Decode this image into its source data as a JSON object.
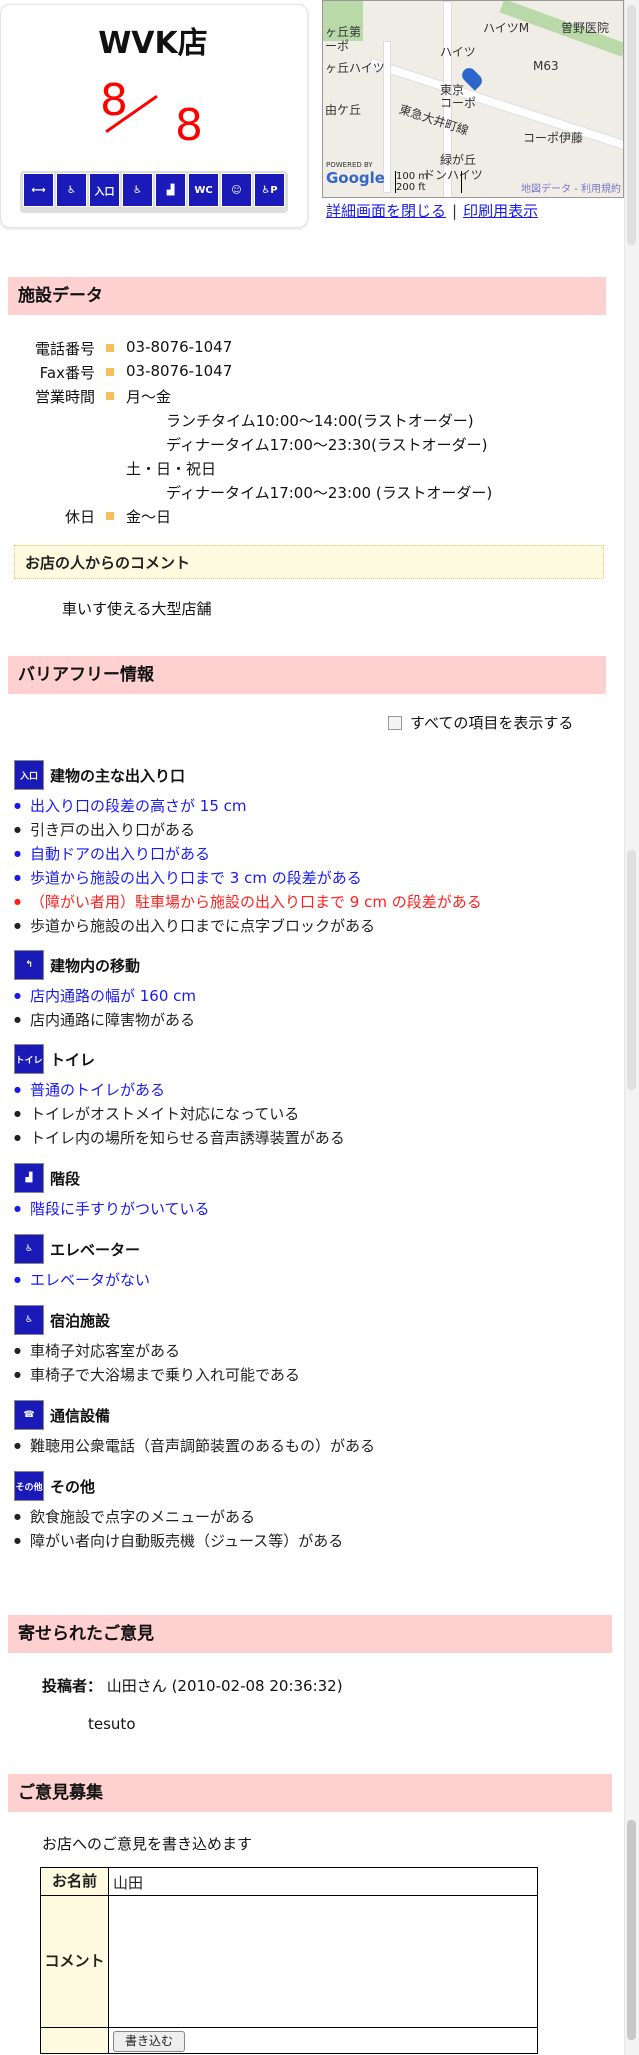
{
  "store": {
    "name": "WVK店",
    "score_num": "8",
    "score_den": "8"
  },
  "icons": [
    "entrance-width-icon",
    "slope-icon",
    "entrance-icon",
    "elevator-icon",
    "stairs-icon",
    "toilet-icon",
    "assist-icon",
    "parking-icon"
  ],
  "map": {
    "labels": [
      "ヶ丘第",
      "ーポ",
      "ヶ丘ハイツ",
      "ハイツ",
      "由ケ丘",
      "東京",
      "コーポ",
      "曽野医院",
      "ハイツM",
      "M63",
      "東急大井町線",
      "コーポ伊藤",
      "緑が丘",
      "ドンハイツ",
      "POWERED BY",
      "Google",
      "100 m",
      "200 ft",
      "地図データ",
      "利用規約"
    ],
    "close_link": "詳細画面を閉じる",
    "print_link": "印刷用表示"
  },
  "facility": {
    "header": "施設データ",
    "phone_label": "電話番号",
    "phone": "03-8076-1047",
    "fax_label": "Fax番号",
    "fax": "03-8076-1047",
    "hours_label": "営業時間",
    "hours": [
      "月〜金",
      "ランチタイム10:00〜14:00(ラストオーダー)",
      "ディナータイム17:00〜23:30(ラストオーダー)",
      "土・日・祝日",
      "ディナータイム17:00〜23:00 (ラストオーダー)"
    ],
    "holiday_label": "休日",
    "holiday": "金〜日",
    "comment_header": "お店の人からのコメント",
    "comment": "車いす使える大型店舗"
  },
  "barrier": {
    "header": "バリアフリー情報",
    "show_all": "すべての項目を表示する",
    "categories": [
      {
        "title": "建物の主な出入り口",
        "icon": "入口",
        "items": [
          {
            "text": "出入り口の段差の高さが 15 cm",
            "color": "blue"
          },
          {
            "text": "引き戸の出入り口がある",
            "color": "black"
          },
          {
            "text": "自動ドアの出入り口がある",
            "color": "blue"
          },
          {
            "text": "歩道から施設の出入り口まで 3 cm の段差がある",
            "color": "blue"
          },
          {
            "text": "（障がい者用）駐車場から施設の出入り口まで 9 cm の段差がある",
            "color": "red"
          },
          {
            "text": "歩道から施設の出入り口までに点字ブロックがある",
            "color": "black"
          }
        ]
      },
      {
        "title": "建物内の移動",
        "icon": "↰",
        "items": [
          {
            "text": "店内通路の幅が 160 cm",
            "color": "blue"
          },
          {
            "text": "店内通路に障害物がある",
            "color": "black"
          }
        ]
      },
      {
        "title": "トイレ",
        "icon": "トイレ",
        "items": [
          {
            "text": "普通のトイレがある",
            "color": "blue"
          },
          {
            "text": "トイレがオストメイト対応になっている",
            "color": "black"
          },
          {
            "text": "トイレ内の場所を知らせる音声誘導装置がある",
            "color": "black"
          }
        ]
      },
      {
        "title": "階段",
        "icon": "▟",
        "items": [
          {
            "text": "階段に手すりがついている",
            "color": "blue"
          }
        ]
      },
      {
        "title": "エレベーター",
        "icon": "♿",
        "items": [
          {
            "text": "エレベータがない",
            "color": "blue"
          }
        ]
      },
      {
        "title": "宿泊施設",
        "icon": "♿",
        "items": [
          {
            "text": "車椅子対応客室がある",
            "color": "black"
          },
          {
            "text": "車椅子で大浴場まで乗り入れ可能である",
            "color": "black"
          }
        ]
      },
      {
        "title": "通信設備",
        "icon": "☎",
        "items": [
          {
            "text": "難聴用公衆電話（音声調節装置のあるもの）がある",
            "color": "black"
          }
        ]
      },
      {
        "title": "その他",
        "icon": "その他",
        "items": [
          {
            "text": "飲食施設で点字のメニューがある",
            "color": "black"
          },
          {
            "text": "障がい者向け自動販売機（ジュース等）がある",
            "color": "black"
          }
        ]
      }
    ]
  },
  "opinions": {
    "header": "寄せられたご意見",
    "poster_label": "投稿者：",
    "poster": "山田さん (2010-02-08 20:36:32)",
    "body": "tesuto"
  },
  "form": {
    "header": "ご意見募集",
    "intro": "お店へのご意見を書き込めます",
    "name_label": "お名前",
    "name_value": "山田",
    "comment_label": "コメント",
    "submit": "書き込む"
  }
}
